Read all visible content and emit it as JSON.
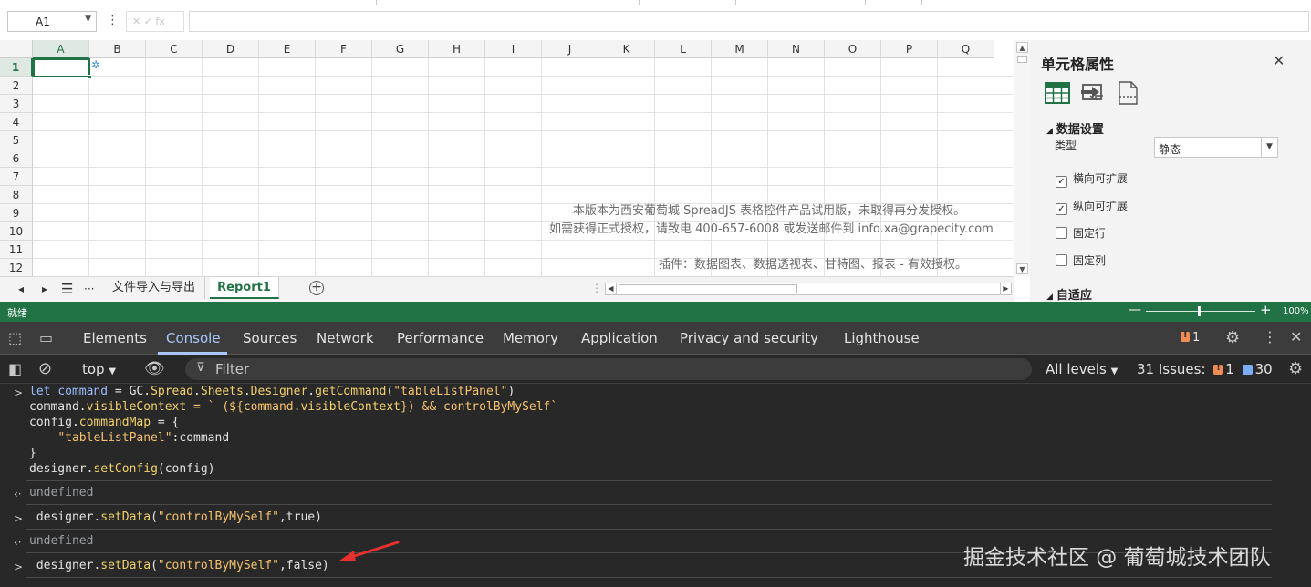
{
  "spreadsheet": {
    "namebox": {
      "value": "A1"
    },
    "fx_box": {
      "text": "✕ ✓ fx"
    },
    "columns": [
      "A",
      "B",
      "C",
      "D",
      "E",
      "F",
      "G",
      "H",
      "I",
      "J",
      "K",
      "L",
      "M",
      "N",
      "O",
      "P",
      "Q"
    ],
    "rows": [
      "1",
      "2",
      "3",
      "4",
      "5",
      "6",
      "7",
      "8",
      "9",
      "10",
      "11",
      "12"
    ],
    "selected_column": "A",
    "selected_row": "1",
    "watermark": {
      "line1": "本版本为西安葡萄城 SpreadJS 表格控件产品试用版，未取得再分发授权。",
      "line2": "如需获得正式授权，请致电 400-657-6008 或发送邮件到 info.xa@grapecity.com",
      "line3": "插件：数据图表、数据透视表、甘特图、报表 - 有效授权。"
    },
    "sheet_tabs": [
      "文件导入与导出",
      "Report1"
    ],
    "active_tab": "Report1"
  },
  "property_panel": {
    "title": "单元格属性",
    "close": "✕",
    "section1": "数据设置",
    "type_label": "类型",
    "type_value": "静态",
    "checkboxes": [
      {
        "label": "横向可扩展",
        "checked": true
      },
      {
        "label": "纵向可扩展",
        "checked": true
      },
      {
        "label": "固定行",
        "checked": false
      },
      {
        "label": "固定列",
        "checked": false
      }
    ],
    "section2": "自适应"
  },
  "statusbar": {
    "status": "就绪",
    "zoom": "100%",
    "zoom_fraction": 0.5,
    "color": "#217346"
  },
  "devtools": {
    "tabs": [
      "Elements",
      "Console",
      "Sources",
      "Network",
      "Performance",
      "Memory",
      "Application",
      "Privacy and security",
      "Lighthouse"
    ],
    "active_tab": "Console",
    "issues_badge": "1",
    "context": "top",
    "filter_placeholder": "Filter",
    "levels": "All levels",
    "issues_label": "31 Issues:",
    "issues_warn": "1",
    "issues_info": "30",
    "accent": "#a8c7fa",
    "console": {
      "l1_a": "let ",
      "l1_b": "command",
      "l1_c": " = GC.",
      "l1_d": "Spread",
      "l1_e": ".",
      "l1_f": "Sheets",
      "l1_g": ".",
      "l1_h": "Designer",
      "l1_i": ".",
      "l1_j": "getCommand",
      "l1_k": "(",
      "l1_l": "\"tableListPanel\"",
      "l1_m": ")",
      "l2_a": "command.",
      "l2_b": "visibleContext",
      "l2_c": " = ` (${command.",
      "l2_d": "visibleContext",
      "l2_e": "}) && controlByMySelf`",
      "l3_a": "config.",
      "l3_b": "commandMap",
      "l3_c": " = {",
      "l4_a": "    ",
      "l4_b": "\"tableListPanel\"",
      "l4_c": ":command",
      "l5": "}",
      "l6_a": "designer.",
      "l6_b": "setConfig",
      "l6_c": "(config)",
      "r1": "undefined",
      "l7_a": " designer.",
      "l7_b": "setData",
      "l7_c": "(",
      "l7_d": "\"controlByMySelf\"",
      "l7_e": ",true)",
      "r2": "undefined",
      "l8_a": " designer.",
      "l8_b": "setData",
      "l8_c": "(",
      "l8_d": "\"controlByMySelf\"",
      "l8_e": ",false)"
    }
  },
  "overlay_watermark": "掘金技术社区 @ 葡萄城技术团队"
}
